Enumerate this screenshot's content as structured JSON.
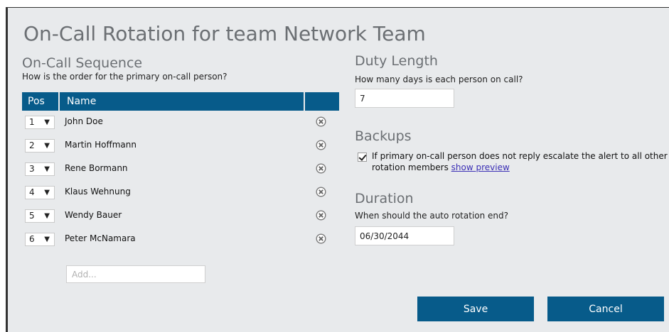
{
  "title": "On-Call Rotation for team Network Team",
  "sequence": {
    "heading": "On-Call Sequence",
    "description": "How is the order for the primary on-call person?",
    "columns": {
      "pos": "Pos",
      "name": "Name"
    },
    "rows": [
      {
        "pos": "1",
        "name": "John Doe"
      },
      {
        "pos": "2",
        "name": "Martin Hoffmann"
      },
      {
        "pos": "3",
        "name": "Rene Bormann"
      },
      {
        "pos": "4",
        "name": "Klaus Wehnung"
      },
      {
        "pos": "5",
        "name": "Wendy Bauer"
      },
      {
        "pos": "6",
        "name": "Peter McNamara"
      }
    ],
    "add_placeholder": "Add..."
  },
  "duty": {
    "heading": "Duty Length",
    "description": "How many days is each person on call?",
    "value": "7"
  },
  "backups": {
    "heading": "Backups",
    "checked": true,
    "text": "If primary on-call person does not reply escalate the alert to all other rotation members",
    "link": "show preview"
  },
  "duration": {
    "heading": "Duration",
    "description": "When should the auto rotation end?",
    "value": "06/30/2044"
  },
  "buttons": {
    "save": "Save",
    "cancel": "Cancel"
  },
  "colors": {
    "header_bg": "#075b8a",
    "panel_bg": "#e8eaec",
    "link": "#3b2fb5"
  }
}
